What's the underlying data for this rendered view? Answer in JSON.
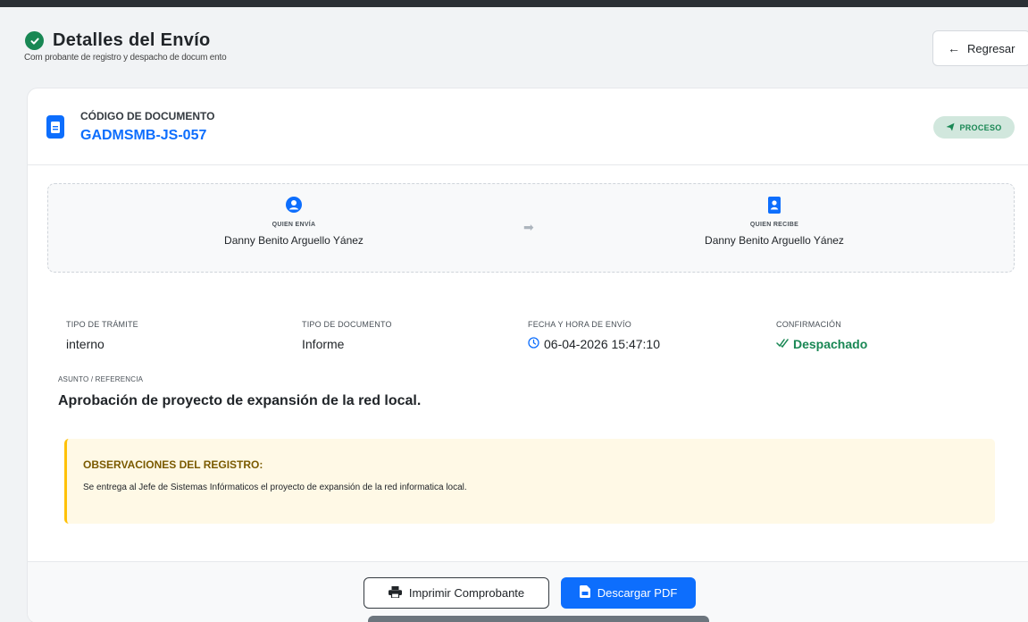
{
  "header": {
    "title": "Detalles del Envío",
    "subtitle": "Com probante de registro y despacho de docum ento",
    "back_label": "Regresar"
  },
  "document": {
    "code_label": "CÓDIGO DE DOCUMENTO",
    "code": "GADMSMB-JS-057",
    "status": "PROCESO"
  },
  "parties": {
    "sender_label": "QUIEN ENVÍA",
    "sender_name": "Danny Benito Arguello Yánez",
    "receiver_label": "QUIEN RECIBE",
    "receiver_name": "Danny Benito Arguello Yánez"
  },
  "info": {
    "tramite_label": "TIPO DE TRÁMITE",
    "tramite_value": "interno",
    "doc_type_label": "TIPO DE DOCUMENTO",
    "doc_type_value": "Informe",
    "fecha_label": "FECHA Y HORA DE ENVÍO",
    "fecha_value": "06-04-2026 15:47:10",
    "confirm_label": "CONFIRMACIÓN",
    "confirm_value": "Despachado"
  },
  "subject": {
    "label": "ASUNTO / REFERENCIA",
    "text": "Aprobación de proyecto de expansión de la red local."
  },
  "observations": {
    "title": "OBSERVACIONES DEL REGISTRO:",
    "text": "Se entrega al Jefe de Sistemas Infórmaticos el proyecto de expansión de la red informatica local."
  },
  "footer": {
    "print_label": "Imprimir Comprobante",
    "pdf_label": "Descargar PDF"
  },
  "colors": {
    "primary": "#0d6efd",
    "success": "#198754",
    "warning": "#ffc107"
  }
}
